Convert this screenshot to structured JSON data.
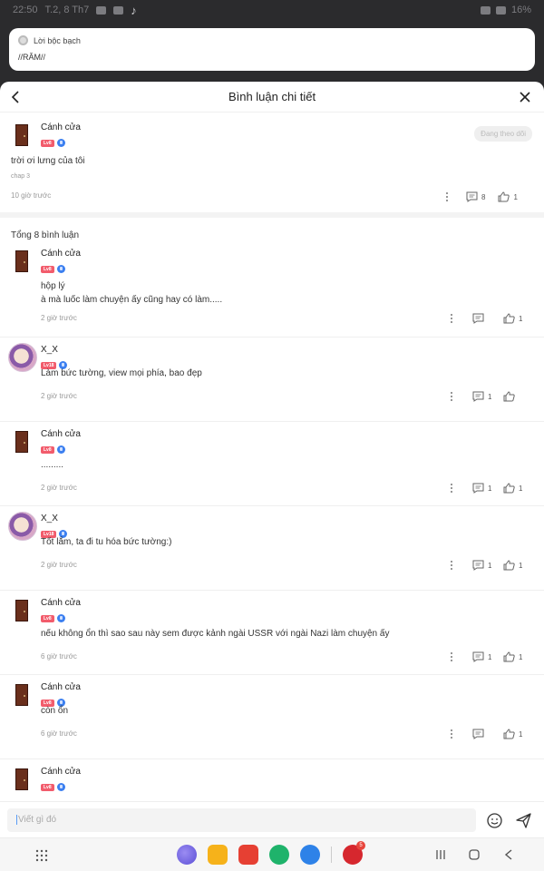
{
  "status_bar": {
    "time": "22:50",
    "date": "T.2, 8 Th7",
    "battery": "16%"
  },
  "notification": {
    "app_label": "Lời bộc bạch",
    "message": "//RĂM//"
  },
  "sheet": {
    "title": "Bình luận chi tiết"
  },
  "main_post": {
    "username": "Cánh cửa",
    "level": "Lv8",
    "follow_label": "Đang theo dõi",
    "text": "trời ơi lưng của tôi",
    "chapter": "chap 3",
    "time": "10 giờ trước",
    "reply_count": "8",
    "like_count": "1"
  },
  "total_label": "Tổng 8 bình luận",
  "comments": [
    {
      "username": "Cánh cửa",
      "level": "Lv8",
      "avatar": "door",
      "line1": "hộp lý",
      "line2": "à mà luốc làm chuyện ấy cũng hay có làm.....",
      "time": "2 giờ trước",
      "reply_count": "",
      "like_count": "1"
    },
    {
      "username": "X_X",
      "level": "Lv18",
      "avatar": "xx",
      "line1": "Làm bức tường, view mọi phía, bao đẹp",
      "line2": "",
      "time": "2 giờ trước",
      "reply_count": "1",
      "like_count": ""
    },
    {
      "username": "Cánh cửa",
      "level": "Lv8",
      "avatar": "door",
      "line1": ".........",
      "line2": "",
      "time": "2 giờ trước",
      "reply_count": "1",
      "like_count": "1"
    },
    {
      "username": "X_X",
      "level": "Lv18",
      "avatar": "xx",
      "line1": "Tốt lắm, ta đi tu hóa bức tường:)",
      "line2": "",
      "time": "2 giờ trước",
      "reply_count": "1",
      "like_count": "1"
    },
    {
      "username": "Cánh cửa",
      "level": "Lv8",
      "avatar": "door",
      "line1": "nếu không ổn thì sao sau này sem được kảnh ngài USSR với ngài Nazi làm chuyện ấy",
      "line2": "",
      "time": "6 giờ trước",
      "reply_count": "1",
      "like_count": "1"
    },
    {
      "username": "Cánh cửa",
      "level": "Lv8",
      "avatar": "door",
      "line1": "còn ổn",
      "line2": "",
      "time": "6 giờ trước",
      "reply_count": "",
      "like_count": "1"
    },
    {
      "username": "Cánh cửa",
      "level": "Lv8",
      "avatar": "door",
      "line1": "",
      "line2": "",
      "time": "",
      "reply_count": "",
      "like_count": ""
    }
  ],
  "input": {
    "placeholder": "Viết gì đó"
  },
  "dock": {
    "notification_badge": "5"
  },
  "icons": [
    "back-icon",
    "close-icon",
    "more-icon",
    "comment-icon",
    "like-icon",
    "emoji-icon",
    "send-icon",
    "app-grid-icon",
    "recent-apps-icon",
    "home-icon",
    "nav-back-icon"
  ]
}
